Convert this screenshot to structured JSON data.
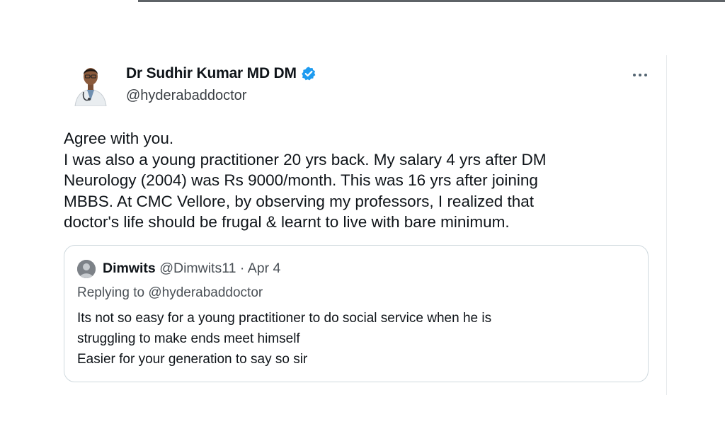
{
  "tweet": {
    "author": {
      "name": "Dr Sudhir Kumar MD DM",
      "handle": "@hyderabaddoctor",
      "verified": true
    },
    "more_icon": "more-horizontal-icon",
    "body_lines": [
      "Agree with you.",
      "I was also a young practitioner 20 yrs back. My salary 4 yrs after DM",
      "Neurology (2004) was Rs 9000/month. This was 16 yrs after joining",
      "MBBS. At CMC Vellore, by observing my professors, I realized that",
      "doctor's life should be frugal & learnt to live with bare minimum."
    ]
  },
  "quoted_tweet": {
    "author_name": "Dimwits",
    "author_meta": "@Dimwits11 · Apr 4",
    "replying_to": "Replying to @hyderabaddoctor",
    "body_lines": [
      "Its not so easy for a young practitioner to do social service when he is",
      "struggling to make ends meet himself",
      "Easier for your generation to say so sir"
    ]
  },
  "colors": {
    "text": "#0f1419",
    "secondary": "#4a5056",
    "verified_blue": "#1d9bf0",
    "border": "#cfd9de"
  }
}
